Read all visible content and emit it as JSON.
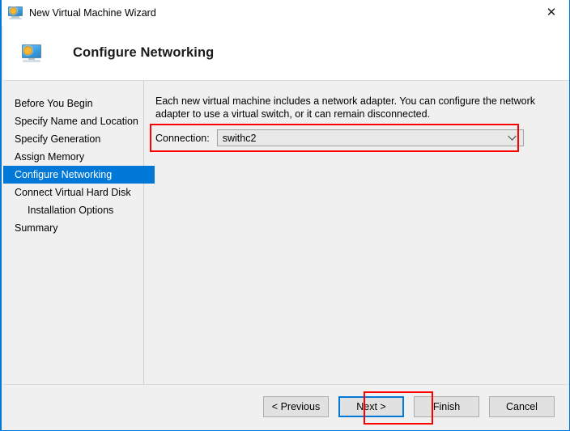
{
  "window": {
    "title": "New Virtual Machine Wizard",
    "icon": "virtual-machine-monitor-icon",
    "close_label": "✕"
  },
  "header": {
    "title": "Configure Networking",
    "icon": "configure-networking-monitor-icon"
  },
  "sidebar": {
    "items": [
      {
        "label": "Before You Begin",
        "selected": false,
        "indented": false
      },
      {
        "label": "Specify Name and Location",
        "selected": false,
        "indented": false
      },
      {
        "label": "Specify Generation",
        "selected": false,
        "indented": false
      },
      {
        "label": "Assign Memory",
        "selected": false,
        "indented": false
      },
      {
        "label": "Configure Networking",
        "selected": true,
        "indented": false
      },
      {
        "label": "Connect Virtual Hard Disk",
        "selected": false,
        "indented": false
      },
      {
        "label": "Installation Options",
        "selected": false,
        "indented": true
      },
      {
        "label": "Summary",
        "selected": false,
        "indented": false
      }
    ]
  },
  "content": {
    "description": "Each new virtual machine includes a network adapter. You can configure the network adapter to use a virtual switch, or it can remain disconnected.",
    "connection_label": "Connection:",
    "connection_value": "swithc2",
    "connection_arrow_icon": "chevron-down-icon"
  },
  "footer": {
    "buttons": [
      {
        "label": "< Previous",
        "focused": false
      },
      {
        "label": "Next >",
        "focused": true
      },
      {
        "label": "Finish",
        "focused": false
      },
      {
        "label": "Cancel",
        "focused": false
      }
    ]
  },
  "annotations": {
    "highlight_color": "#ff0000",
    "accent_color": "#0078d7",
    "connection_highlight": "red-box-connection",
    "next_highlight": "red-box-next-button"
  }
}
